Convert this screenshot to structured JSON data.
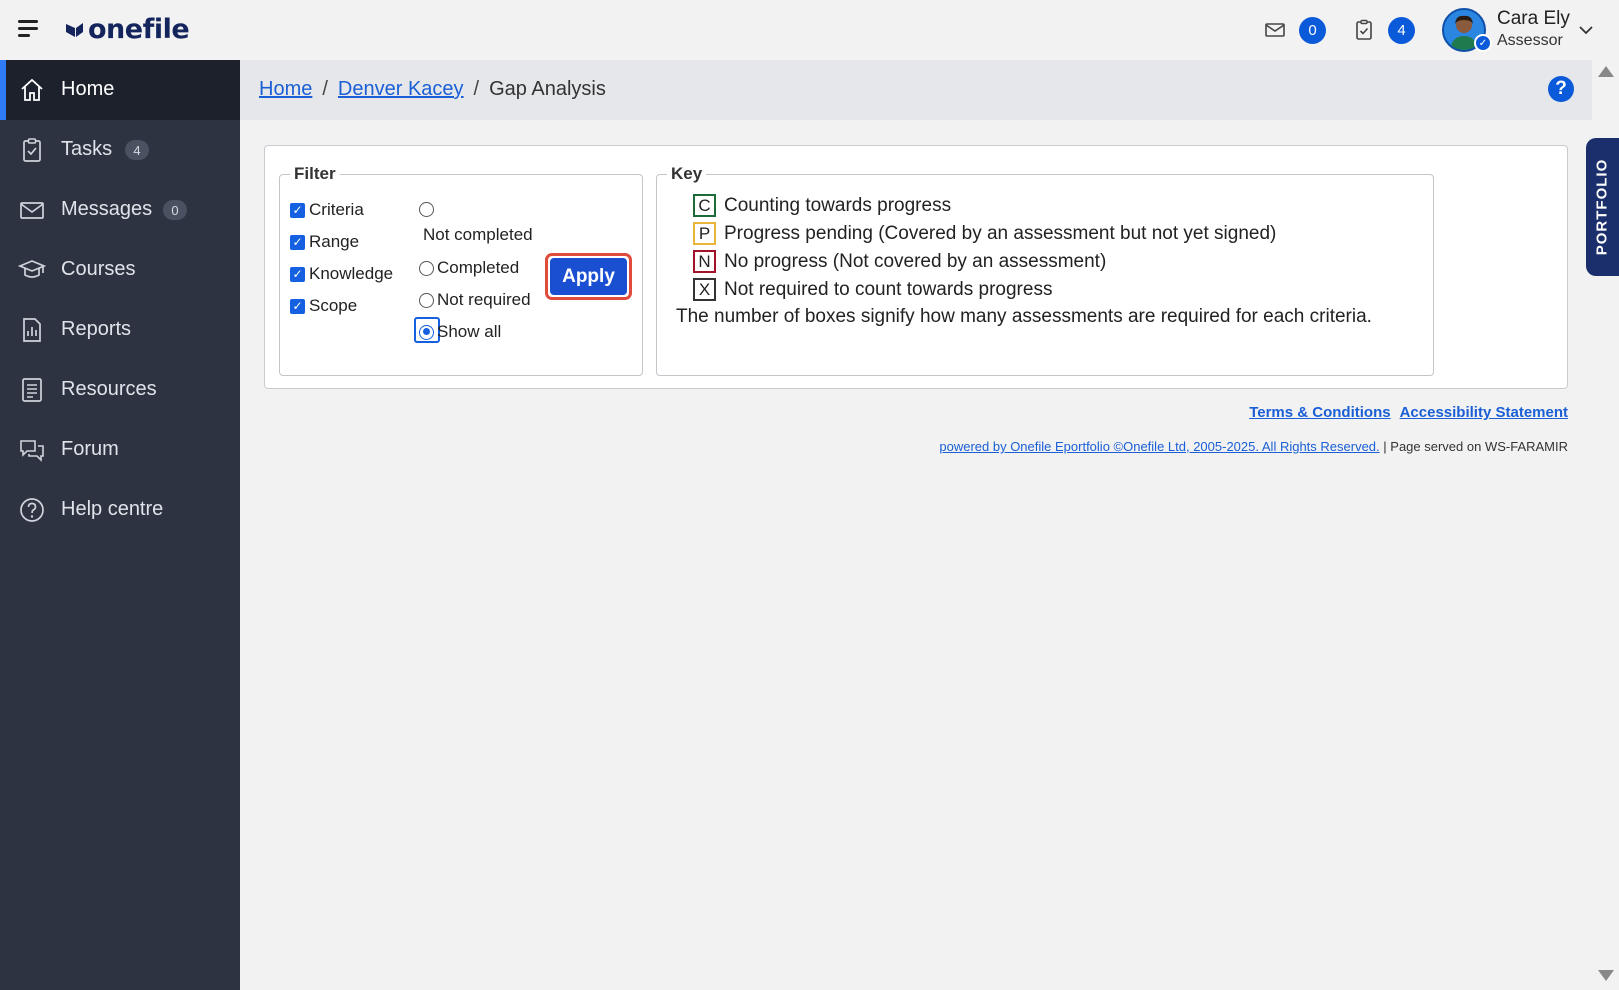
{
  "brand": {
    "logo_text": "onefile"
  },
  "header": {
    "messages_count": "0",
    "tasks_count": "4",
    "user_name": "Cara Ely",
    "user_role": "Assessor"
  },
  "sidebar": {
    "items": [
      {
        "label": "Home",
        "icon": "home-icon",
        "active": true
      },
      {
        "label": "Tasks",
        "icon": "clipboard-check-icon",
        "count": "4"
      },
      {
        "label": "Messages",
        "icon": "envelope-icon",
        "count": "0"
      },
      {
        "label": "Courses",
        "icon": "graduation-cap-icon"
      },
      {
        "label": "Reports",
        "icon": "report-icon"
      },
      {
        "label": "Resources",
        "icon": "resources-icon"
      },
      {
        "label": "Forum",
        "icon": "forum-icon"
      },
      {
        "label": "Help centre",
        "icon": "question-circle-icon"
      }
    ]
  },
  "breadcrumb": {
    "home": "Home",
    "learner": "Denver Kacey",
    "current": "Gap Analysis",
    "separator": "/"
  },
  "filter": {
    "legend": "Filter",
    "checkboxes": [
      {
        "label": "Criteria",
        "checked": true
      },
      {
        "label": "Range",
        "checked": true
      },
      {
        "label": "Knowledge",
        "checked": true
      },
      {
        "label": "Scope",
        "checked": true
      }
    ],
    "radios": [
      {
        "label": "Not completed",
        "selected": false
      },
      {
        "label": "Completed",
        "selected": false
      },
      {
        "label": "Not required",
        "selected": false
      },
      {
        "label": "Show all",
        "selected": true
      }
    ],
    "apply_label": "Apply"
  },
  "key": {
    "legend": "Key",
    "items": [
      {
        "letter": "C",
        "text": "Counting towards progress",
        "color": "#1e6b3a"
      },
      {
        "letter": "P",
        "text": "Progress pending (Covered by an assessment but not yet signed)",
        "color": "#e6b53a"
      },
      {
        "letter": "N",
        "text": "No progress (Not covered by an assessment)",
        "color": "#a3122a"
      },
      {
        "letter": "X",
        "text": "Not required to count towards progress",
        "color": "#333333"
      }
    ],
    "note": "The number of boxes signify how many assessments are required for each criteria."
  },
  "footer": {
    "terms": "Terms & Conditions",
    "accessibility": "Accessibility Statement",
    "powered": "powered by Onefile Eportfolio ©Onefile Ltd, 2005-2025. All Rights Reserved.",
    "served": "| Page served on WS-FARAMIR"
  },
  "portfolio_tab": "PORTFOLIO",
  "help_glyph": "?",
  "colors": {
    "accent": "#0b5ad9",
    "sidebar": "#2d3341",
    "sidebar_active": "#1c212c",
    "focus": "#e04b3c"
  }
}
